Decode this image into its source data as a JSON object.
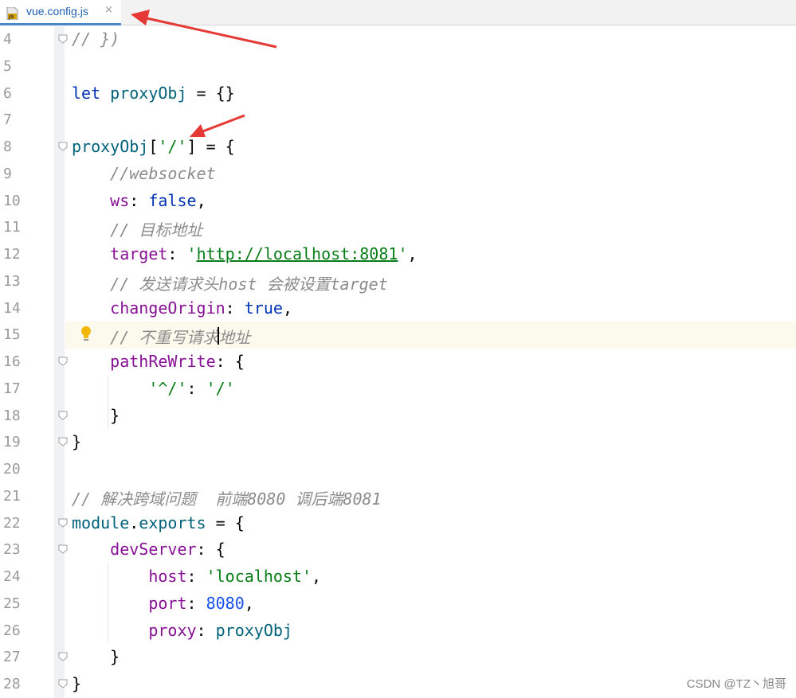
{
  "tab": {
    "filename": "vue.config.js",
    "icon": "javascript-file-icon",
    "close_glyph": "×"
  },
  "watermark": "CSDN @TZ丶旭哥",
  "colors": {
    "keyword": "#0033b3",
    "property": "#871094",
    "string": "#067d17",
    "number": "#1750eb",
    "comment": "#8c8c8c",
    "accent": "#4a88c7",
    "arrow": "#e53935"
  },
  "lines": [
    {
      "n": "4",
      "t": [
        {
          "c": "cmt",
          "s": "// })"
        }
      ]
    },
    {
      "n": "5",
      "t": []
    },
    {
      "n": "6",
      "t": [
        {
          "c": "kw",
          "s": "let "
        },
        {
          "c": "var",
          "s": "proxyObj"
        },
        {
          "c": "",
          "s": " = {}"
        }
      ]
    },
    {
      "n": "7",
      "t": []
    },
    {
      "n": "8",
      "t": [
        {
          "c": "var",
          "s": "proxyObj"
        },
        {
          "c": "",
          "s": "["
        },
        {
          "c": "str",
          "s": "'/'"
        },
        {
          "c": "",
          "s": "] = {"
        }
      ]
    },
    {
      "n": "9",
      "t": [
        {
          "c": "",
          "s": "    "
        },
        {
          "c": "cmt",
          "s": "//websocket"
        }
      ]
    },
    {
      "n": "10",
      "t": [
        {
          "c": "",
          "s": "    "
        },
        {
          "c": "prop",
          "s": "ws"
        },
        {
          "c": "",
          "s": ": "
        },
        {
          "c": "kw",
          "s": "false"
        },
        {
          "c": "",
          "s": ","
        }
      ]
    },
    {
      "n": "11",
      "t": [
        {
          "c": "",
          "s": "    "
        },
        {
          "c": "cmt",
          "s": "// 目标地址"
        }
      ]
    },
    {
      "n": "12",
      "t": [
        {
          "c": "",
          "s": "    "
        },
        {
          "c": "prop",
          "s": "target"
        },
        {
          "c": "",
          "s": ": "
        },
        {
          "c": "str",
          "s": "'"
        },
        {
          "c": "url",
          "s": "http://localhost:8081"
        },
        {
          "c": "str",
          "s": "'"
        },
        {
          "c": "",
          "s": ","
        }
      ]
    },
    {
      "n": "13",
      "t": [
        {
          "c": "",
          "s": "    "
        },
        {
          "c": "cmt",
          "s": "// 发送请求头host 会被设置target"
        }
      ]
    },
    {
      "n": "14",
      "t": [
        {
          "c": "",
          "s": "    "
        },
        {
          "c": "prop",
          "s": "changeOrigin"
        },
        {
          "c": "",
          "s": ": "
        },
        {
          "c": "kw",
          "s": "true"
        },
        {
          "c": "",
          "s": ","
        }
      ]
    },
    {
      "n": "15",
      "t": [
        {
          "c": "",
          "s": "    "
        },
        {
          "c": "cmt",
          "s": "// 不重写请求地址"
        }
      ]
    },
    {
      "n": "16",
      "t": [
        {
          "c": "",
          "s": "    "
        },
        {
          "c": "prop",
          "s": "pathReWrite"
        },
        {
          "c": "",
          "s": ": {"
        }
      ]
    },
    {
      "n": "17",
      "t": [
        {
          "c": "",
          "s": "        "
        },
        {
          "c": "str",
          "s": "'^/'"
        },
        {
          "c": "",
          "s": ": "
        },
        {
          "c": "str",
          "s": "'/'"
        }
      ]
    },
    {
      "n": "18",
      "t": [
        {
          "c": "",
          "s": "    }"
        }
      ]
    },
    {
      "n": "19",
      "t": [
        {
          "c": "",
          "s": "}"
        }
      ]
    },
    {
      "n": "20",
      "t": []
    },
    {
      "n": "21",
      "t": [
        {
          "c": "cmt",
          "s": "// 解决跨域问题  前端8080 调后端8081"
        }
      ]
    },
    {
      "n": "22",
      "t": [
        {
          "c": "gvar",
          "s": "module"
        },
        {
          "c": "",
          "s": "."
        },
        {
          "c": "gvar",
          "s": "exports"
        },
        {
          "c": "",
          "s": " = {"
        }
      ]
    },
    {
      "n": "23",
      "t": [
        {
          "c": "",
          "s": "    "
        },
        {
          "c": "prop",
          "s": "devServer"
        },
        {
          "c": "",
          "s": ": {"
        }
      ]
    },
    {
      "n": "24",
      "t": [
        {
          "c": "",
          "s": "        "
        },
        {
          "c": "prop",
          "s": "host"
        },
        {
          "c": "",
          "s": ": "
        },
        {
          "c": "str",
          "s": "'localhost'"
        },
        {
          "c": "",
          "s": ","
        }
      ]
    },
    {
      "n": "25",
      "t": [
        {
          "c": "",
          "s": "        "
        },
        {
          "c": "prop",
          "s": "port"
        },
        {
          "c": "",
          "s": ": "
        },
        {
          "c": "num",
          "s": "8080"
        },
        {
          "c": "",
          "s": ","
        }
      ]
    },
    {
      "n": "26",
      "t": [
        {
          "c": "",
          "s": "        "
        },
        {
          "c": "prop",
          "s": "proxy"
        },
        {
          "c": "",
          "s": ": "
        },
        {
          "c": "var",
          "s": "proxyObj"
        }
      ]
    },
    {
      "n": "27",
      "t": [
        {
          "c": "",
          "s": "    }"
        }
      ]
    },
    {
      "n": "28",
      "t": [
        {
          "c": "",
          "s": "}"
        }
      ]
    }
  ],
  "fold_open_lines": [
    "4",
    "8",
    "16",
    "18",
    "19",
    "22",
    "23",
    "27",
    "28"
  ],
  "intention_icon": "lightbulb-icon",
  "caret_line": "15"
}
